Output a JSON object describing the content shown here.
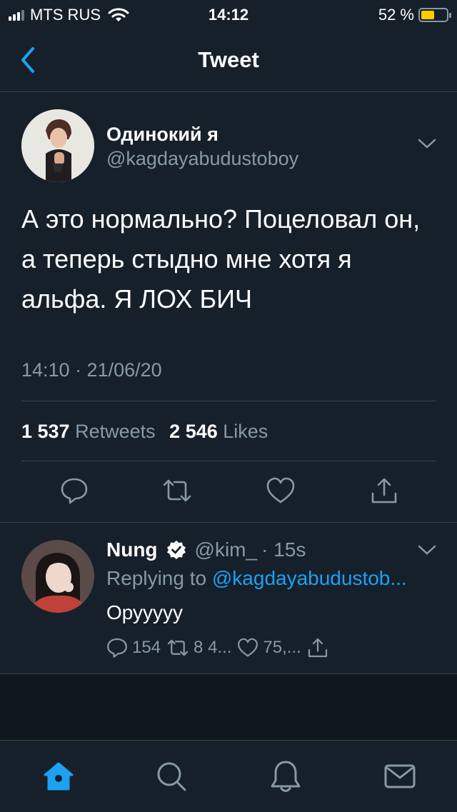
{
  "status_bar": {
    "carrier": "MTS RUS",
    "time": "14:12",
    "battery_percent": "52 %",
    "battery_level": 0.52
  },
  "header": {
    "title": "Tweet",
    "back_icon": "chevron-left-icon"
  },
  "tweet": {
    "author_name": "Одинокий я",
    "author_handle": "@kagdayabudustoboy",
    "text": "А это нормально? Поцеловал он, а теперь стыдно мне хотя я альфа. Я ЛОХ БИЧ",
    "timestamp": "14:10 · 21/06/20",
    "retweets_count": "1 537",
    "retweets_label": "Retweets",
    "likes_count": "2 546",
    "likes_label": "Likes",
    "action_icons": [
      "reply-icon",
      "retweet-icon",
      "like-icon",
      "share-icon"
    ]
  },
  "reply": {
    "author_name": "Nung",
    "verified_icon": "verified-badge-icon",
    "author_handle": "@kim_",
    "time": "· 15s",
    "replying_prefix": "Replying to",
    "replying_handle": "@kagdayabudustob...",
    "text": "Орууууу",
    "reply_count": "154",
    "retweet_count": "8 4...",
    "like_count": "75,..."
  },
  "tab_bar": {
    "items": [
      "home-icon",
      "search-icon",
      "notifications-icon",
      "messages-icon"
    ],
    "active": "home-icon",
    "accent": "#1da1f2"
  },
  "colors": {
    "background": "#15202b",
    "secondary_text": "#8899a6",
    "accent": "#1da1f2",
    "divider": "#38444d"
  }
}
